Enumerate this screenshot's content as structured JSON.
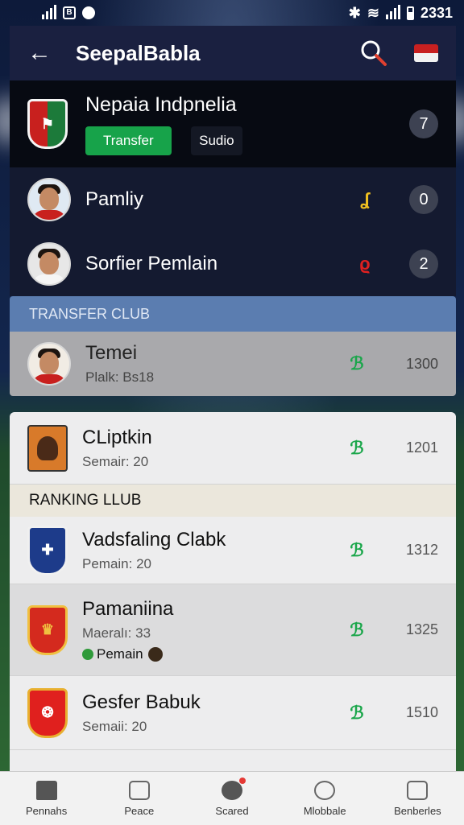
{
  "status": {
    "time": "2331"
  },
  "header": {
    "title": "SeepalBabla"
  },
  "featured": {
    "name": "Nepaia Indpnelia",
    "primary_button": "Transfer",
    "secondary_button": "Sudio",
    "count": "7"
  },
  "dark_rows": [
    {
      "name": "Pamliy",
      "trend_glyph": "ʆ",
      "trend_color": "#f0c020",
      "count": "0"
    },
    {
      "name": "Sorfier Pemlain",
      "trend_glyph": "ϱ",
      "trend_color": "#e02020",
      "count": "2"
    }
  ],
  "transfer_section": {
    "title": "TRANSFER CLUB",
    "row": {
      "name": "Temei",
      "sub": "Plalk: Bs18",
      "trend_glyph": "ℬ",
      "trend_color": "#1aa64a",
      "score": "1300"
    }
  },
  "list": {
    "first": {
      "name": "CLiptkin",
      "sub": "Semair: 20",
      "trend_glyph": "ℬ",
      "trend_color": "#1aa64a",
      "score": "1201"
    },
    "ranking_title": "RANKING LLUB",
    "items": [
      {
        "name": "Vadsfaling Clabk",
        "sub": "Pemain: 20",
        "trend_glyph": "ℬ",
        "trend_color": "#1aa64a",
        "score": "1312"
      },
      {
        "name": "Pamaniina",
        "sub": "Maeralı: 33",
        "badge_label": "Pemain",
        "trend_glyph": "ℬ",
        "trend_color": "#1aa64a",
        "score": "1325"
      },
      {
        "name": "Gesfer Babuk",
        "sub": "Semaii: 20",
        "trend_glyph": "ℬ",
        "trend_color": "#1aa64a",
        "score": "1510"
      }
    ]
  },
  "nav": [
    {
      "label": "Pennahs",
      "icon": "home-icon"
    },
    {
      "label": "Peace",
      "icon": "calendar-icon"
    },
    {
      "label": "Scared",
      "icon": "chat-icon"
    },
    {
      "label": "Mlobbale",
      "icon": "compass-icon"
    },
    {
      "label": "Benberles",
      "icon": "clipboard-icon"
    }
  ],
  "colors": {
    "accent_green": "#17a34a",
    "header_bg": "#1a2040",
    "section_blue": "#5b7db0"
  }
}
